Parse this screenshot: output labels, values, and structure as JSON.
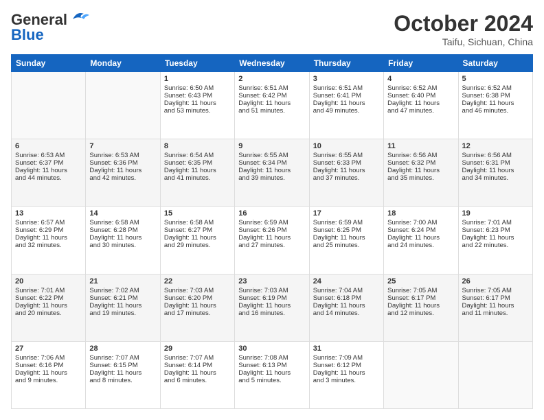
{
  "header": {
    "logo_line1": "General",
    "logo_line2": "Blue",
    "month": "October 2024",
    "location": "Taifu, Sichuan, China"
  },
  "weekdays": [
    "Sunday",
    "Monday",
    "Tuesday",
    "Wednesday",
    "Thursday",
    "Friday",
    "Saturday"
  ],
  "weeks": [
    [
      {
        "day": "",
        "info": ""
      },
      {
        "day": "",
        "info": ""
      },
      {
        "day": "1",
        "info": "Sunrise: 6:50 AM\nSunset: 6:43 PM\nDaylight: 11 hours\nand 53 minutes."
      },
      {
        "day": "2",
        "info": "Sunrise: 6:51 AM\nSunset: 6:42 PM\nDaylight: 11 hours\nand 51 minutes."
      },
      {
        "day": "3",
        "info": "Sunrise: 6:51 AM\nSunset: 6:41 PM\nDaylight: 11 hours\nand 49 minutes."
      },
      {
        "day": "4",
        "info": "Sunrise: 6:52 AM\nSunset: 6:40 PM\nDaylight: 11 hours\nand 47 minutes."
      },
      {
        "day": "5",
        "info": "Sunrise: 6:52 AM\nSunset: 6:38 PM\nDaylight: 11 hours\nand 46 minutes."
      }
    ],
    [
      {
        "day": "6",
        "info": "Sunrise: 6:53 AM\nSunset: 6:37 PM\nDaylight: 11 hours\nand 44 minutes."
      },
      {
        "day": "7",
        "info": "Sunrise: 6:53 AM\nSunset: 6:36 PM\nDaylight: 11 hours\nand 42 minutes."
      },
      {
        "day": "8",
        "info": "Sunrise: 6:54 AM\nSunset: 6:35 PM\nDaylight: 11 hours\nand 41 minutes."
      },
      {
        "day": "9",
        "info": "Sunrise: 6:55 AM\nSunset: 6:34 PM\nDaylight: 11 hours\nand 39 minutes."
      },
      {
        "day": "10",
        "info": "Sunrise: 6:55 AM\nSunset: 6:33 PM\nDaylight: 11 hours\nand 37 minutes."
      },
      {
        "day": "11",
        "info": "Sunrise: 6:56 AM\nSunset: 6:32 PM\nDaylight: 11 hours\nand 35 minutes."
      },
      {
        "day": "12",
        "info": "Sunrise: 6:56 AM\nSunset: 6:31 PM\nDaylight: 11 hours\nand 34 minutes."
      }
    ],
    [
      {
        "day": "13",
        "info": "Sunrise: 6:57 AM\nSunset: 6:29 PM\nDaylight: 11 hours\nand 32 minutes."
      },
      {
        "day": "14",
        "info": "Sunrise: 6:58 AM\nSunset: 6:28 PM\nDaylight: 11 hours\nand 30 minutes."
      },
      {
        "day": "15",
        "info": "Sunrise: 6:58 AM\nSunset: 6:27 PM\nDaylight: 11 hours\nand 29 minutes."
      },
      {
        "day": "16",
        "info": "Sunrise: 6:59 AM\nSunset: 6:26 PM\nDaylight: 11 hours\nand 27 minutes."
      },
      {
        "day": "17",
        "info": "Sunrise: 6:59 AM\nSunset: 6:25 PM\nDaylight: 11 hours\nand 25 minutes."
      },
      {
        "day": "18",
        "info": "Sunrise: 7:00 AM\nSunset: 6:24 PM\nDaylight: 11 hours\nand 24 minutes."
      },
      {
        "day": "19",
        "info": "Sunrise: 7:01 AM\nSunset: 6:23 PM\nDaylight: 11 hours\nand 22 minutes."
      }
    ],
    [
      {
        "day": "20",
        "info": "Sunrise: 7:01 AM\nSunset: 6:22 PM\nDaylight: 11 hours\nand 20 minutes."
      },
      {
        "day": "21",
        "info": "Sunrise: 7:02 AM\nSunset: 6:21 PM\nDaylight: 11 hours\nand 19 minutes."
      },
      {
        "day": "22",
        "info": "Sunrise: 7:03 AM\nSunset: 6:20 PM\nDaylight: 11 hours\nand 17 minutes."
      },
      {
        "day": "23",
        "info": "Sunrise: 7:03 AM\nSunset: 6:19 PM\nDaylight: 11 hours\nand 16 minutes."
      },
      {
        "day": "24",
        "info": "Sunrise: 7:04 AM\nSunset: 6:18 PM\nDaylight: 11 hours\nand 14 minutes."
      },
      {
        "day": "25",
        "info": "Sunrise: 7:05 AM\nSunset: 6:17 PM\nDaylight: 11 hours\nand 12 minutes."
      },
      {
        "day": "26",
        "info": "Sunrise: 7:05 AM\nSunset: 6:17 PM\nDaylight: 11 hours\nand 11 minutes."
      }
    ],
    [
      {
        "day": "27",
        "info": "Sunrise: 7:06 AM\nSunset: 6:16 PM\nDaylight: 11 hours\nand 9 minutes."
      },
      {
        "day": "28",
        "info": "Sunrise: 7:07 AM\nSunset: 6:15 PM\nDaylight: 11 hours\nand 8 minutes."
      },
      {
        "day": "29",
        "info": "Sunrise: 7:07 AM\nSunset: 6:14 PM\nDaylight: 11 hours\nand 6 minutes."
      },
      {
        "day": "30",
        "info": "Sunrise: 7:08 AM\nSunset: 6:13 PM\nDaylight: 11 hours\nand 5 minutes."
      },
      {
        "day": "31",
        "info": "Sunrise: 7:09 AM\nSunset: 6:12 PM\nDaylight: 11 hours\nand 3 minutes."
      },
      {
        "day": "",
        "info": ""
      },
      {
        "day": "",
        "info": ""
      }
    ]
  ]
}
